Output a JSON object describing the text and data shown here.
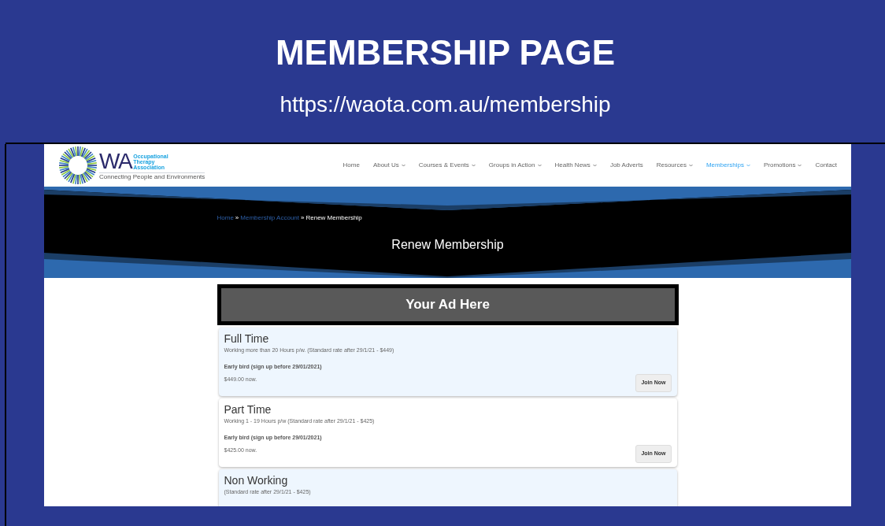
{
  "slide": {
    "title": "MEMBERSHIP PAGE",
    "url": "https://waota.com.au/membership"
  },
  "logo": {
    "mark": "WA",
    "name_lines": [
      "Occupational",
      "Therapy",
      "Association"
    ],
    "tagline": "Connecting People and Environments"
  },
  "nav": [
    {
      "label": "Home",
      "has_menu": false,
      "selected": false
    },
    {
      "label": "About Us",
      "has_menu": true,
      "selected": false
    },
    {
      "label": "Courses & Events",
      "has_menu": true,
      "selected": false
    },
    {
      "label": "Groups in Action",
      "has_menu": true,
      "selected": false
    },
    {
      "label": "Health News",
      "has_menu": true,
      "selected": false
    },
    {
      "label": "Job Adverts",
      "has_menu": false,
      "selected": false
    },
    {
      "label": "Resources",
      "has_menu": true,
      "selected": false
    },
    {
      "label": "Memberships",
      "has_menu": true,
      "selected": true
    },
    {
      "label": "Promotions",
      "has_menu": true,
      "selected": false
    },
    {
      "label": "Contact",
      "has_menu": false,
      "selected": false
    }
  ],
  "breadcrumb": [
    {
      "label": "Home",
      "link": true
    },
    {
      "label": "Membership Account",
      "link": true
    },
    {
      "label": "Renew Membership",
      "link": false
    }
  ],
  "breadcrumb_separator": "»",
  "page_title": "Renew Membership",
  "ad": "Your Ad Here",
  "levels": [
    {
      "name": "Full Time",
      "description": "Working more than 20 Hours p/w. (Standard rate after 29/1/21 - $449)",
      "offer": "Early bird (sign up before 29/01/2021)",
      "price": "$449.00 now.",
      "button": "Join Now"
    },
    {
      "name": "Part Time",
      "description": "Working 1 - 19 Hours p/w (Standard rate after 29/1/21 - $425)",
      "offer": "Early bird (sign up before 29/01/2021)",
      "price": "$425.00 now.",
      "button": "Join Now"
    },
    {
      "name": "Non Working",
      "description": "(Standard rate after 29/1/21 - $425)"
    }
  ]
}
